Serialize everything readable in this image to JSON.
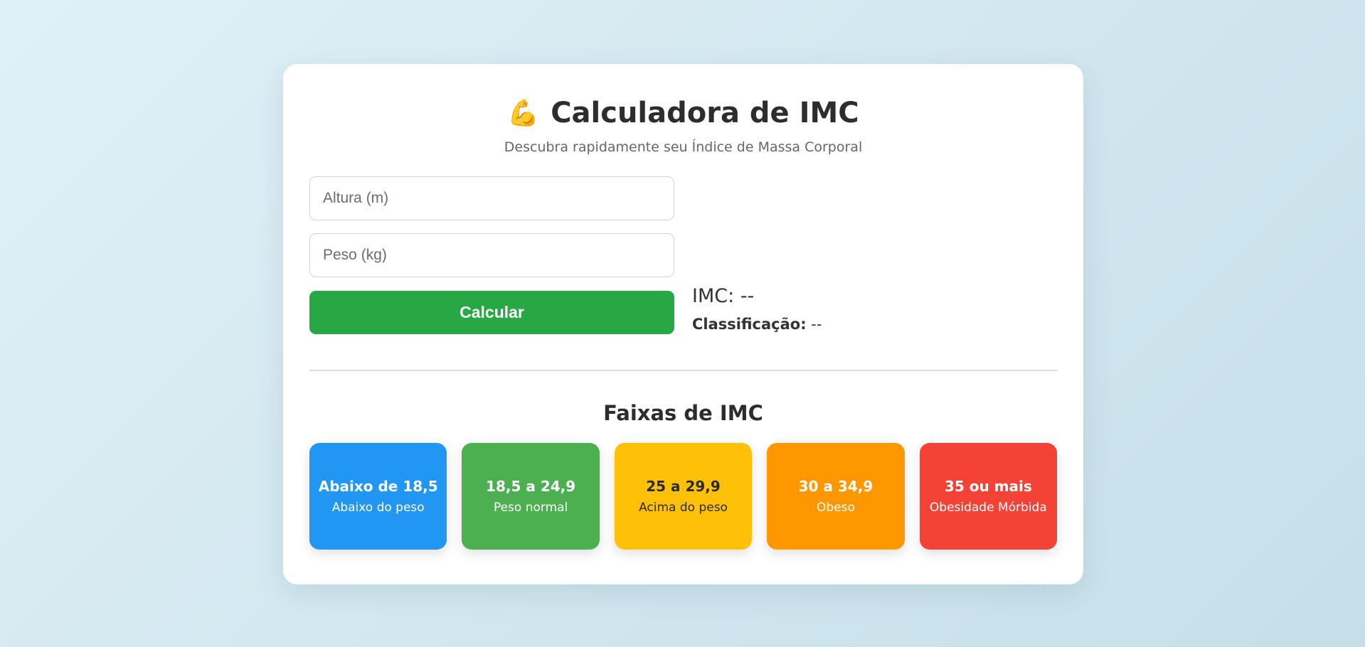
{
  "header": {
    "icon": "flexed-biceps-icon",
    "icon_glyph": "💪",
    "title": "Calculadora de IMC",
    "subtitle": "Descubra rapidamente seu Índice de Massa Corporal"
  },
  "form": {
    "height_placeholder": "Altura (m)",
    "height_value": "",
    "weight_placeholder": "Peso (kg)",
    "weight_value": "",
    "calculate_label": "Calcular",
    "button_color": "#28a745"
  },
  "result": {
    "imc_label": "IMC:",
    "imc_value": "--",
    "class_label": "Classificação:",
    "class_value": "--"
  },
  "ranges": {
    "title": "Faixas de IMC",
    "items": [
      {
        "value": "Abaixo de 18,5",
        "desc": "Abaixo do peso",
        "color": "#2196f3"
      },
      {
        "value": "18,5 a 24,9",
        "desc": "Peso normal",
        "color": "#4caf50"
      },
      {
        "value": "25 a 29,9",
        "desc": "Acima do peso",
        "color": "#ffc107"
      },
      {
        "value": "30 a 34,9",
        "desc": "Obeso",
        "color": "#ff9800"
      },
      {
        "value": "35 ou mais",
        "desc": "Obesidade Mórbida",
        "color": "#f44336"
      }
    ]
  }
}
